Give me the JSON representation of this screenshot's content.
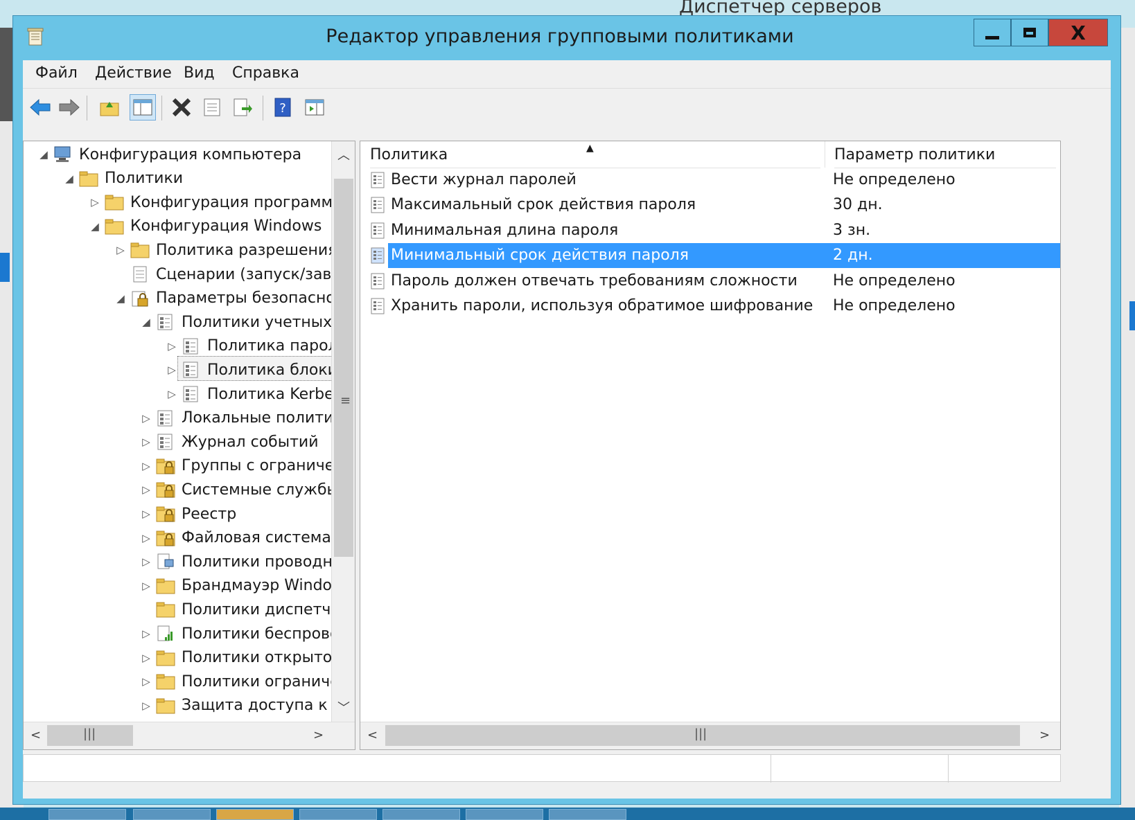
{
  "background": {
    "server_manager_title": "Диспетчер серверов"
  },
  "window": {
    "title": "Редактор управления групповыми политиками",
    "controls": {
      "close_glyph": "X"
    }
  },
  "menu": [
    "Файл",
    "Действие",
    "Вид",
    "Справка"
  ],
  "toolbar": {
    "buttons": [
      "back-arrow-icon",
      "forward-arrow-icon",
      "up-folder-icon",
      "show-hide-tree-icon",
      "delete-icon",
      "properties-icon",
      "export-list-icon",
      "help-icon",
      "show-action-pane-icon"
    ]
  },
  "tree": {
    "nodes": [
      {
        "label": "Конфигурация компьютера",
        "icon": "computer-icon",
        "expander": "◢"
      },
      {
        "label": "Политики",
        "icon": "folder-icon",
        "expander": "◢"
      },
      {
        "label": "Конфигурация программ",
        "icon": "folder-icon",
        "expander": "▷"
      },
      {
        "label": "Конфигурация Windows",
        "icon": "folder-icon",
        "expander": "◢"
      },
      {
        "label": "Политика разрешения и",
        "icon": "folder-icon",
        "expander": "▷"
      },
      {
        "label": "Сценарии (запуск/завер",
        "icon": "script-icon",
        "expander": ""
      },
      {
        "label": "Параметры безопаснос",
        "icon": "security-settings-icon",
        "expander": "◢"
      },
      {
        "label": "Политики учетных з",
        "icon": "policy-group-icon",
        "expander": "◢"
      },
      {
        "label": "Политика пароле",
        "icon": "policy-group-icon",
        "expander": "▷"
      },
      {
        "label": "Политика блоки",
        "icon": "policy-group-icon",
        "expander": "▷"
      },
      {
        "label": "Политика Kerber",
        "icon": "policy-group-icon",
        "expander": "▷"
      },
      {
        "label": "Локальные политик",
        "icon": "policy-group-icon",
        "expander": "▷"
      },
      {
        "label": "Журнал событий",
        "icon": "policy-group-icon",
        "expander": "▷"
      },
      {
        "label": "Группы с ограничен",
        "icon": "locked-folder-icon",
        "expander": "▷"
      },
      {
        "label": "Системные службы",
        "icon": "locked-folder-icon",
        "expander": "▷"
      },
      {
        "label": "Реестр",
        "icon": "locked-folder-icon",
        "expander": "▷"
      },
      {
        "label": "Файловая система",
        "icon": "locked-folder-icon",
        "expander": "▷"
      },
      {
        "label": "Политики проводно",
        "icon": "wired-network-icon",
        "expander": "▷"
      },
      {
        "label": "Брандмауэр Window",
        "icon": "folder-icon",
        "expander": "▷"
      },
      {
        "label": "Политики диспетчер",
        "icon": "folder-icon",
        "expander": ""
      },
      {
        "label": "Политики беспрово",
        "icon": "wireless-network-icon",
        "expander": "▷"
      },
      {
        "label": "Политики открытого",
        "icon": "folder-icon",
        "expander": "▷"
      },
      {
        "label": "Политики ограниче",
        "icon": "folder-icon",
        "expander": "▷"
      },
      {
        "label": "Защита доступа к се",
        "icon": "folder-icon",
        "expander": "▷"
      }
    ]
  },
  "list": {
    "columns": [
      "Политика",
      "Параметр политики"
    ],
    "rows": [
      {
        "name": "Вести журнал паролей",
        "value": "Не определено"
      },
      {
        "name": "Максимальный срок действия пароля",
        "value": "30 дн."
      },
      {
        "name": "Минимальная длина пароля",
        "value": "3 зн."
      },
      {
        "name": "Минимальный срок действия пароля",
        "value": "2 дн."
      },
      {
        "name": "Пароль должен отвечать требованиям сложности",
        "value": "Не определено"
      },
      {
        "name": "Хранить пароли, используя обратимое шифрование",
        "value": "Не определено"
      }
    ],
    "selected_index": 3
  },
  "colors": {
    "titlebar": "#6ac4e6",
    "close_button": "#c7473c",
    "selection": "#3399ff"
  }
}
